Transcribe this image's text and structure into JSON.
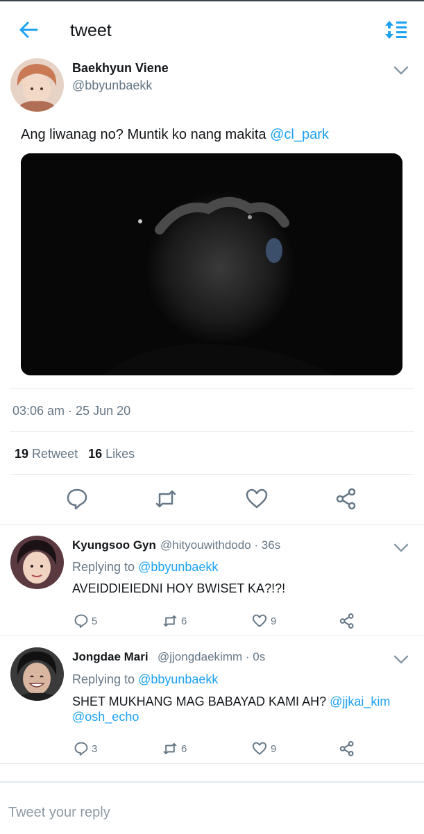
{
  "header": {
    "title": "tweet"
  },
  "tweet": {
    "author_name": "Baekhyun Viene",
    "author_handle": "@bbyunbaekk",
    "text": "Ang liwanag no? Muntik ko nang makita",
    "mention": "@cl_park",
    "timestamp": "03:06 am · 25 Jun 20",
    "retweet_count": "19",
    "retweet_label": "Retweet",
    "likes_count": "16",
    "likes_label": "Likes"
  },
  "replies": [
    {
      "name": "Kyungsoo Gyn",
      "meta": "@hityouwithdodo · 36s",
      "replying_prefix": "Replying to",
      "replying_to": "@bbyunbaekk",
      "text": "AVEIDDIEIEDNI HOY BWISET KA?!?!",
      "mention1": "",
      "mention2": "",
      "replies": "5",
      "retweets": "6",
      "likes": "9"
    },
    {
      "name": "Jongdae Mari",
      "meta": "@jjongdaekimm · 0s",
      "replying_prefix": "Replying to",
      "replying_to": "@bbyunbaekk",
      "text": "SHET MUKHANG MAG BABAYAD KAMI AH?",
      "mention1": "@jjkai_kim",
      "mention2": "@osh_echo",
      "replies": "3",
      "retweets": "6",
      "likes": "9"
    }
  ],
  "reply_box": {
    "placeholder": "Tweet your reply"
  },
  "colors": {
    "accent": "#1da1f2",
    "secondary_text": "#657786",
    "divider": "#e1e8ed"
  }
}
